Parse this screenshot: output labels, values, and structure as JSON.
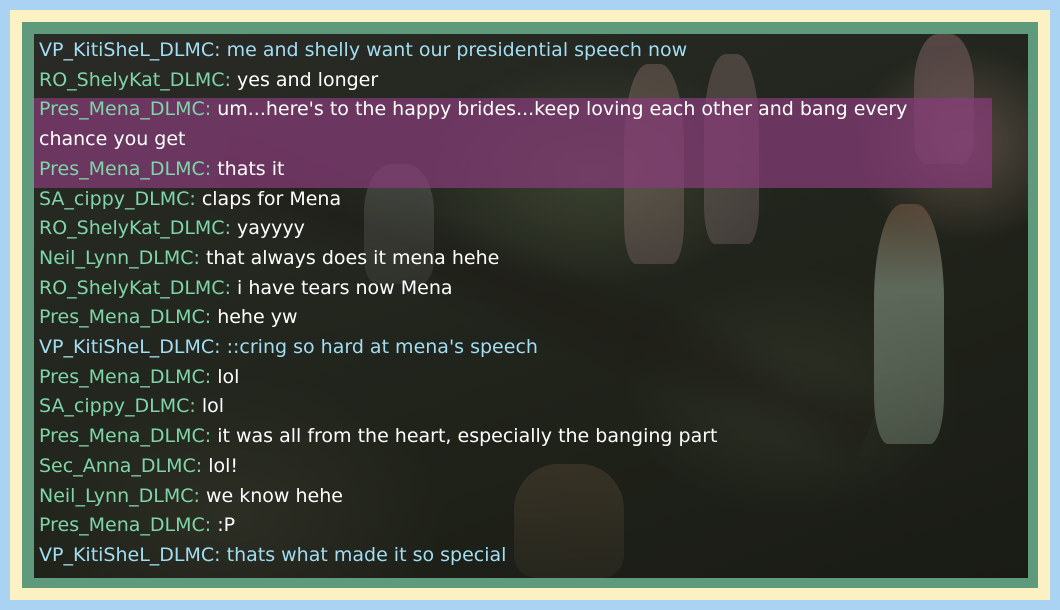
{
  "chat": {
    "messages": [
      {
        "name": "VP_KitiSheL_DLMC:",
        "text": " me and shelly want our presidential speech now",
        "style": "blue"
      },
      {
        "name": "RO_ShelyKat_DLMC:",
        "text": " yes and longer",
        "style": "normal"
      },
      {
        "name": "Pres_Mena_DLMC:",
        "text": " um...here's to the happy brides...keep loving each other and bang every chance you get",
        "style": "normal"
      },
      {
        "name": "Pres_Mena_DLMC:",
        "text": " thats it",
        "style": "normal"
      },
      {
        "name": "SA_cippy_DLMC:",
        "text": " claps for Mena",
        "style": "normal"
      },
      {
        "name": "RO_ShelyKat_DLMC:",
        "text": " yayyyy",
        "style": "normal"
      },
      {
        "name": "Neil_Lynn_DLMC:",
        "text": " that always does it mena hehe",
        "style": "normal"
      },
      {
        "name": "RO_ShelyKat_DLMC:",
        "text": " i have tears now Mena",
        "style": "normal"
      },
      {
        "name": "Pres_Mena_DLMC:",
        "text": " hehe yw",
        "style": "normal"
      },
      {
        "name": "VP_KitiSheL_DLMC:",
        "text": " ::cring so hard at mena's speech",
        "style": "blue"
      },
      {
        "name": "Pres_Mena_DLMC:",
        "text": " lol",
        "style": "normal"
      },
      {
        "name": "SA_cippy_DLMC:",
        "text": " lol",
        "style": "normal"
      },
      {
        "name": "Pres_Mena_DLMC:",
        "text": " it was all from the heart, especially the banging part",
        "style": "normal"
      },
      {
        "name": "Sec_Anna_DLMC:",
        "text": " lol!",
        "style": "normal"
      },
      {
        "name": "Neil_Lynn_DLMC:",
        "text": " we know hehe",
        "style": "normal"
      },
      {
        "name": "Pres_Mena_DLMC:",
        "text": " :P",
        "style": "normal"
      },
      {
        "name": "VP_KitiSheL_DLMC:",
        "text": " thats what made it so special",
        "style": "blue"
      }
    ]
  },
  "colors": {
    "outer_border": "#a9d2f3",
    "cream_border": "#fbf1c3",
    "green_border": "#5f9a7d",
    "name_green": "#7fd4a8",
    "vp_blue": "#a2ddf2",
    "highlight": "#863c78"
  }
}
